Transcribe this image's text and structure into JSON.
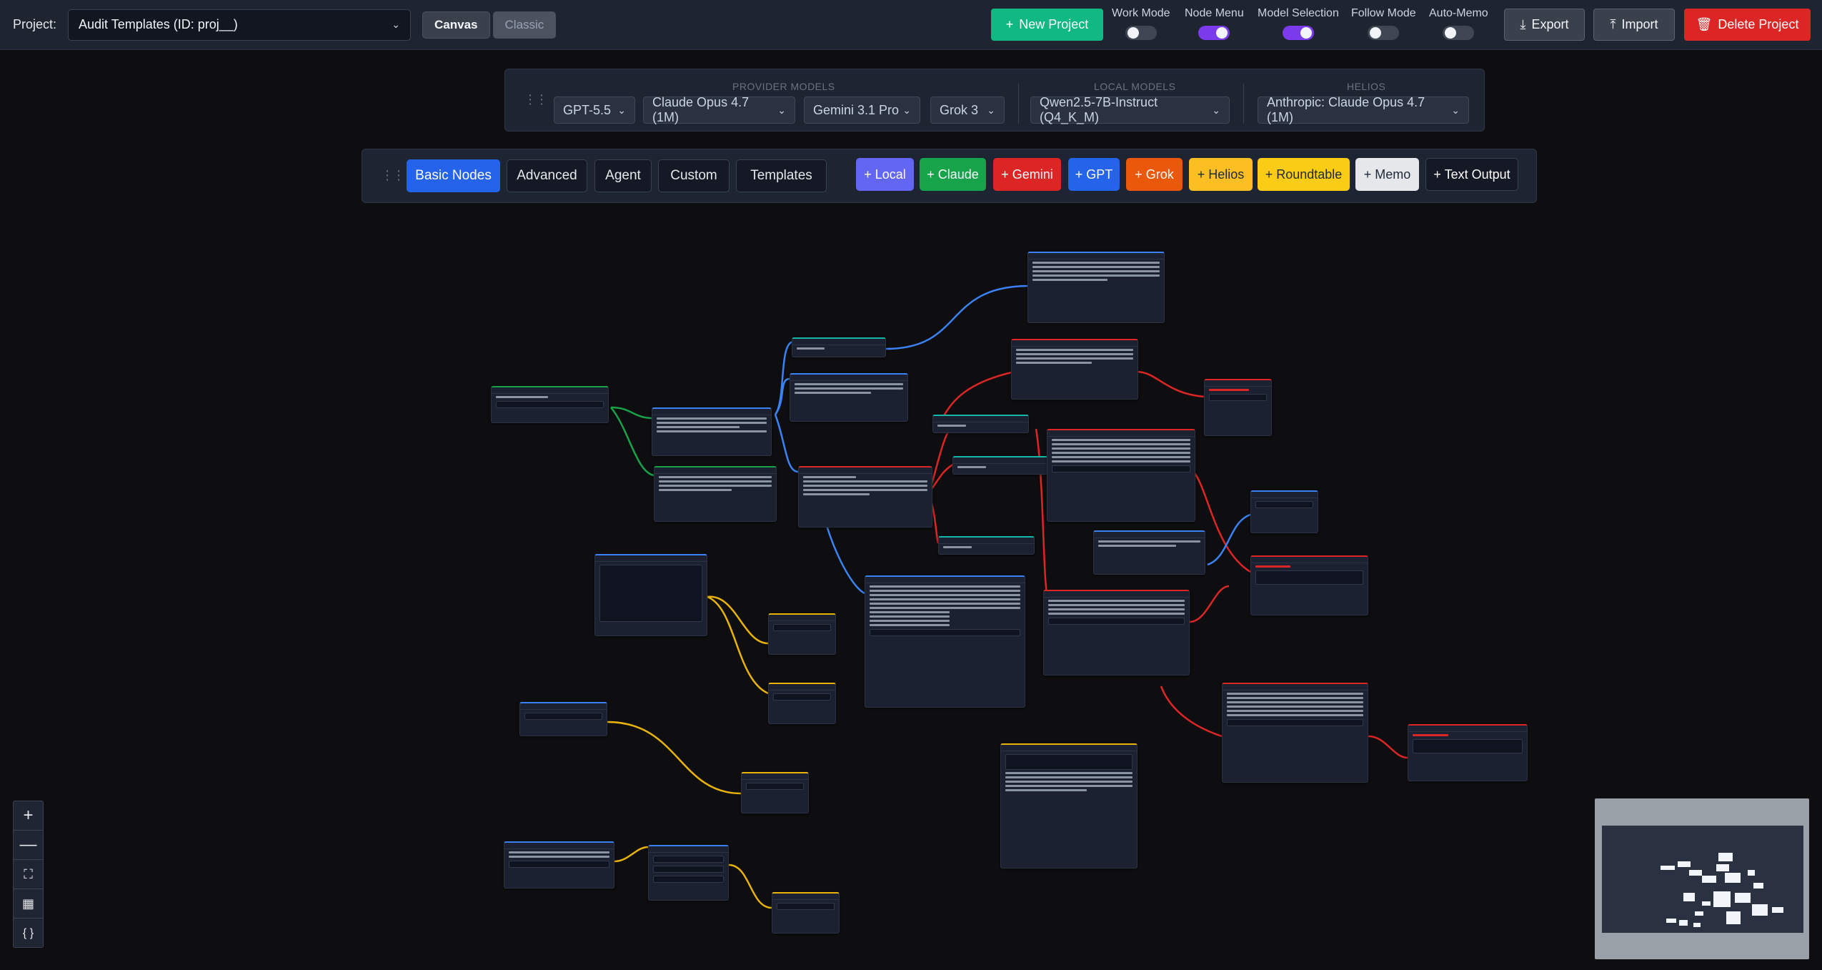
{
  "topbar": {
    "project_label": "Project:",
    "project_value": "Audit Templates (ID: proj__)",
    "view_modes": [
      "Canvas",
      "Classic"
    ],
    "new_project": "New Project",
    "toggles": [
      {
        "label": "Work Mode",
        "on": false
      },
      {
        "label": "Node Menu",
        "on": true
      },
      {
        "label": "Model Selection",
        "on": true
      },
      {
        "label": "Follow Mode",
        "on": false
      },
      {
        "label": "Auto-Memo",
        "on": false
      }
    ],
    "export": "Export",
    "import": "Import",
    "delete_project": "Delete Project"
  },
  "model_bar": {
    "provider_label": "PROVIDER MODELS",
    "local_label": "LOCAL MODELS",
    "helios_label": "HELIOS",
    "provider_models": [
      "GPT-5.5",
      "Claude Opus 4.7 (1M)",
      "Gemini 3.1 Pro",
      "Grok 3"
    ],
    "local_model": "Qwen2.5-7B-Instruct (Q4_K_M)",
    "helios_model": "Anthropic: Claude Opus 4.7 (1M)"
  },
  "tabs": [
    "Basic Nodes",
    "Advanced",
    "Agent",
    "Custom",
    "Templates"
  ],
  "add_chips": [
    {
      "label": "+ Local",
      "bg": "#6366f1",
      "fg": "#ffffff"
    },
    {
      "label": "+ Claude",
      "bg": "#16a34a",
      "fg": "#ffffff"
    },
    {
      "label": "+ Gemini",
      "bg": "#dc2626",
      "fg": "#ffffff"
    },
    {
      "label": "+ GPT",
      "bg": "#2563eb",
      "fg": "#ffffff"
    },
    {
      "label": "+ Grok",
      "bg": "#ea580c",
      "fg": "#ffffff"
    },
    {
      "label": "+ Helios",
      "bg": "#fbbf24",
      "fg": "#1f2937"
    },
    {
      "label": "+ Roundtable",
      "bg": "#facc15",
      "fg": "#1f2937"
    },
    {
      "label": "+ Memo",
      "bg": "#e5e7eb",
      "fg": "#1f2937"
    },
    {
      "label": "+ Text Output",
      "bg": "#141925",
      "fg": "#ffffff"
    }
  ],
  "canvas_controls": [
    "zoom-in",
    "zoom-out",
    "fit-view",
    "grid",
    "code"
  ],
  "colors": {
    "accent": "#2563eb",
    "edge_claude": "#16a34a",
    "edge_gpt": "#3b82f6",
    "edge_gemini": "#dc2626",
    "edge_helios": "#eab308"
  }
}
